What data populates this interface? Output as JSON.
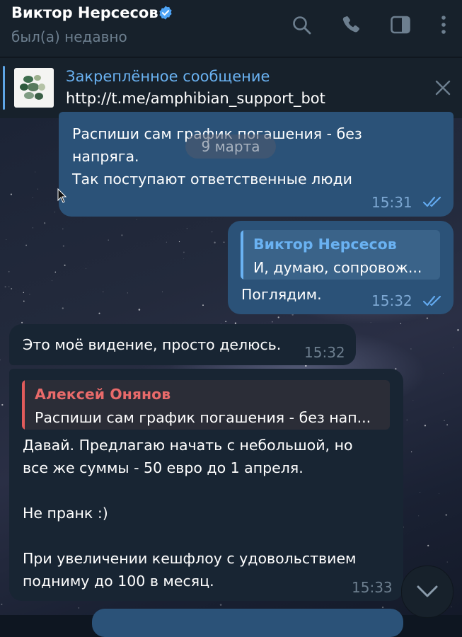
{
  "header": {
    "name": "Виктор Нерсесов",
    "status": "был(а) недавно"
  },
  "pinned": {
    "title": "Закреплённое сообщение",
    "text": "http://t.me/amphibian_support_bot"
  },
  "date_label": "9 марта",
  "messages": [
    {
      "text": "Распиши сам график погашения - без\nнапряга.\nТак поступают ответственные люди",
      "time": "15:31"
    },
    {
      "reply_name": "Виктор Нерсесов",
      "reply_text": "И, думаю, сопровож...",
      "text": "Поглядим.",
      "time": "15:32"
    },
    {
      "text": "Это моё видение, просто делюсь.",
      "time": "15:32"
    },
    {
      "reply_name": "Алексей Онянов",
      "reply_text": "Распиши сам график погашения - без нап...",
      "text": "Давай. Предлагаю начать с небольшой, но\nвсе же суммы - 50 евро до 1 апреля.\n\nНе пранк :)\n\nПри увеличении кешфлоу с удовольствием\nподниму до 100 в месяц.",
      "time": "15:33"
    }
  ],
  "colors": {
    "outgoing": "#2b5278",
    "incoming": "#182533",
    "accent": "#6ab2f2",
    "reply_red": "#e05b5b"
  }
}
